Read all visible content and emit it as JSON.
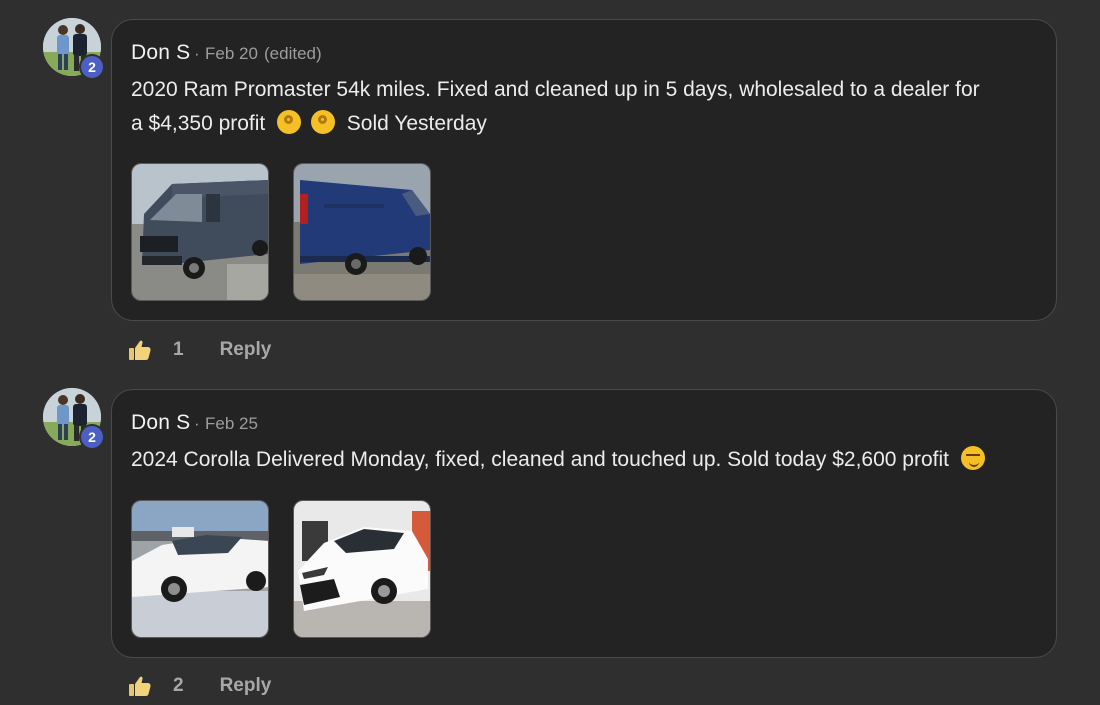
{
  "comments": [
    {
      "author": "Don S",
      "separator": "·",
      "date": "Feb 20",
      "edited": "(edited)",
      "badge": "2",
      "text_line1": "2020 Ram Promaster 54k miles. Fixed and cleaned up in 5 days, wholesaled to a dealer for",
      "text_line2_a": "a $4,350 profit",
      "text_line2_emojis": [
        "ok-hand-emoji",
        "ok-hand-emoji"
      ],
      "text_line2_b": "Sold Yesterday",
      "images": [
        "blue-van-front-photo",
        "blue-van-side-photo"
      ],
      "likes": "1",
      "reply_label": "Reply"
    },
    {
      "author": "Don S",
      "separator": "·",
      "date": "Feb 25",
      "badge": "2",
      "text_line1": "2024 Corolla Delivered Monday, fixed, cleaned and touched up. Sold today $2,600 profit",
      "text_line1_emoji": "smirk-emoji",
      "images": [
        "white-corolla-outdoor-photo",
        "white-corolla-garage-photo"
      ],
      "likes": "2",
      "reply_label": "Reply"
    }
  ],
  "colors": {
    "background": "#2f2f2f",
    "card": "#232323",
    "badge": "#4c5fc4",
    "muted_text": "#9d9d9d"
  }
}
